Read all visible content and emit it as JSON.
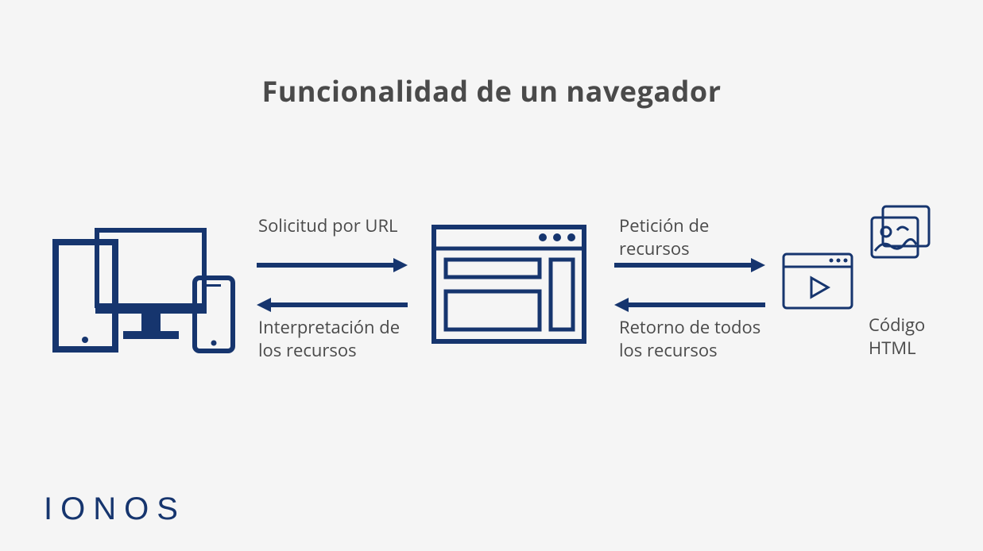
{
  "title": "Funcionalidad de un navegador",
  "arrows": {
    "request_left": "Solicitud por URL",
    "response_left": "Interpretación de los recursos",
    "request_right": "Petición de recursos",
    "response_right": "Retorno de todos los recursos"
  },
  "right_caption": "Código HTML",
  "brand": "IONOS",
  "colors": {
    "navy": "#16356e",
    "text": "#4a4a4a",
    "bg": "#f5f5f5"
  },
  "icons": {
    "devices": "devices-icon",
    "browser": "browser-window-icon",
    "video": "video-window-icon",
    "images": "image-stack-icon"
  }
}
